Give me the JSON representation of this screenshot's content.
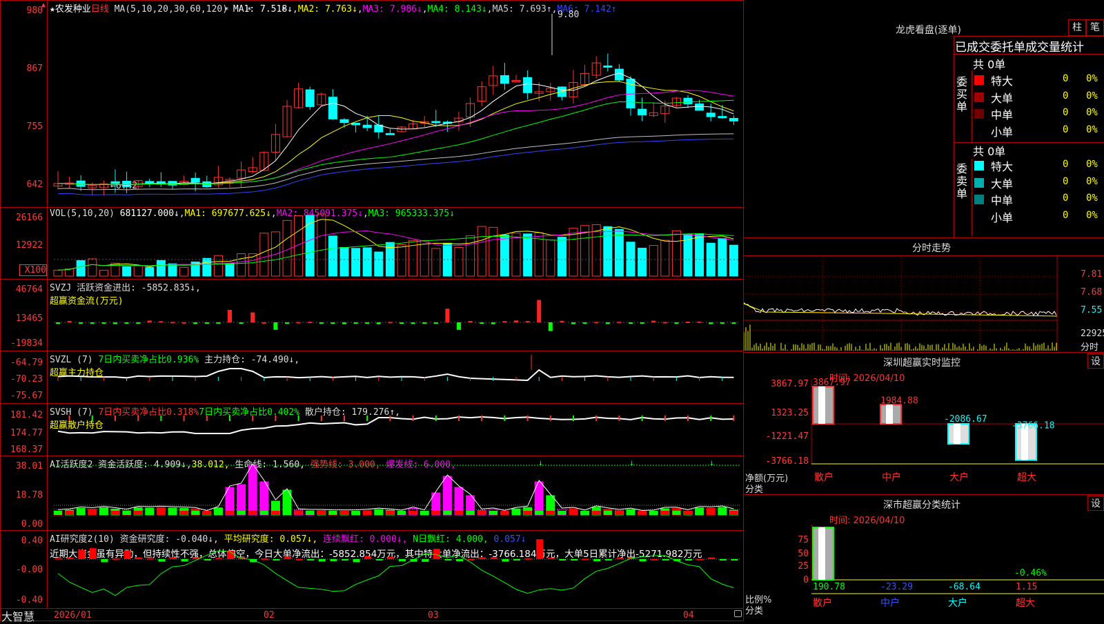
{
  "stock": {
    "star": "★",
    "name": "农发种业",
    "period": "日线"
  },
  "ma_header": {
    "label": "MA(5,10,20,30,60,120)",
    "items": [
      {
        "text": "MA1: 7.518↓",
        "color": "#ffffff"
      },
      {
        "text": "MA2: 7.763↓",
        "color": "#ffff00"
      },
      {
        "text": "MA3: 7.986↓",
        "color": "#ff00ff"
      },
      {
        "text": "MA4: 8.143↓",
        "color": "#00ff00"
      },
      {
        "text": "MA5: 7.693↑",
        "color": "#c0c0c0"
      },
      {
        "text": "MA6: 7.142↑",
        "color": "#3333ff"
      }
    ]
  },
  "price_axis": [
    "980",
    "867",
    "755",
    "642"
  ],
  "price_high_label": "9.80",
  "price_low_label": "←6.42",
  "vol_header": {
    "label": "VOL(5,10,20)",
    "items": [
      {
        "text": "681127.000↓",
        "color": "#ffffff"
      },
      {
        "text": "MA1: 697677.625↓",
        "color": "#ffff00"
      },
      {
        "text": "MA2: 845091.375↓",
        "color": "#ff00ff"
      },
      {
        "text": "MA3: 965333.375↓",
        "color": "#00ff00"
      }
    ]
  },
  "vol_axis": [
    "26166",
    "12922",
    "X100"
  ],
  "svzj": {
    "line1": "SVZJ  活跃资金进出: -5852.835↓,",
    "line2": "超赢资金流(万元)",
    "axis": [
      "46764",
      "13465",
      "-19834"
    ]
  },
  "svzl": {
    "line1a": "SVZL (7) ",
    "line1b": "7日内买卖净占比0.936%",
    "line1c": " 主力持仓: -74.490↓,",
    "line2": "超赢主力持仓",
    "axis": [
      "-64.79",
      "-70.23",
      "-75.67"
    ]
  },
  "svsh": {
    "line1a": "SVSH (7) ",
    "line1b": "7日内买卖净占比0.318%",
    "line1c": "7日内买卖净占比0.402%",
    "line1d": " 散户持仓: 179.276↑,",
    "line2": "超赢散户持仓",
    "axis": [
      "181.42",
      "174.77",
      "168.37"
    ]
  },
  "ai2": {
    "a": "AI活跃度2 资金活跃度: 4.909↓,",
    "b": "38.012,",
    "c": " 生命线: 1.560,",
    "d": " 强势线: 3.000,",
    "e": " 爆发线: 6.000,",
    "axis": [
      "38.01",
      "18.78",
      "0.00"
    ]
  },
  "aiy": {
    "a": "AI研究度2(10) 资金研究度: -0.040↓,",
    "b": " 平均研究度: 0.057↓,",
    "c": " 连续飘红: 0.000↓,",
    "d": " N日飘红: 4.000,",
    "e": " 0.057↓",
    "line2": "近期大资金虽有异动，但持续性不强，总体偏空，今日大单净流出：-5852.854万元，其中特大单净流出：-3766.184万元，大单5日累计净出-5271.982万元",
    "axis": [
      "0.40",
      "-0.00",
      "-0.40"
    ]
  },
  "date_axis": [
    "2026/01",
    "02",
    "03",
    "04"
  ],
  "brand": "大智慧",
  "dragon": {
    "title": "龙虎看盘(逐单)",
    "btn1": "柱",
    "btn2": "笔",
    "subtitle": "已成交委托单成交量统计",
    "buy": {
      "side": "委买单",
      "total": "共 0单",
      "rows": [
        {
          "label": "特大",
          "val": "0",
          "pct": "0%",
          "color": "#ff0000"
        },
        {
          "label": "大单",
          "val": "0",
          "pct": "0%",
          "color": "#a00000"
        },
        {
          "label": "中单",
          "val": "0",
          "pct": "0%",
          "color": "#700000"
        },
        {
          "label": "小单",
          "val": "0",
          "pct": "0%",
          "color": "#000000"
        }
      ]
    },
    "sell": {
      "side": "委卖单",
      "total": "共 0单",
      "rows": [
        {
          "label": "特大",
          "val": "0",
          "pct": "0%",
          "color": "#00ffff"
        },
        {
          "label": "大单",
          "val": "0",
          "pct": "0%",
          "color": "#00b0b0"
        },
        {
          "label": "中单",
          "val": "0",
          "pct": "0%",
          "color": "#008080"
        },
        {
          "label": "小单",
          "val": "0",
          "pct": "0%",
          "color": "#000000"
        }
      ]
    }
  },
  "intraday": {
    "title": "分时走势",
    "axis": [
      "7.81",
      "7.68",
      "7.55",
      "22925"
    ],
    "bottom": "分时"
  },
  "sz_monitor": {
    "title": "深圳超赢实时监控",
    "btn": "设",
    "time": "时间: 2026/04/10",
    "axis": [
      "3867.97",
      "1323.25",
      "-1221.47",
      "-3766.18"
    ],
    "ylabel": "净额(万元)",
    "xlabel": "分类",
    "bars": [
      {
        "cat": "散户",
        "value": 3867.97,
        "label": "3867.97"
      },
      {
        "cat": "中户",
        "value": 1984.88,
        "label": "1984.88"
      },
      {
        "cat": "大户",
        "value": -2086.67,
        "label": "-2086.67"
      },
      {
        "cat": "超大",
        "value": -3766.18,
        "label": "-3766.18"
      }
    ]
  },
  "sz_class": {
    "title": "深市超赢分类统计",
    "btn": "设",
    "time": "时间: 2026/04/10",
    "axis": [
      "75",
      "50",
      "25",
      "0"
    ],
    "ylabel": "比例%",
    "xlabel": "分类",
    "cats": [
      "散户",
      "中户",
      "大户",
      "超大"
    ],
    "values": [
      {
        "text": "190.78",
        "color": "#00ff00"
      },
      {
        "text": "-23.29",
        "color": "#3355ff"
      },
      {
        "text": "-68.64",
        "color": "#00ffff"
      },
      {
        "text": "1.15",
        "color": "#ff3333"
      }
    ],
    "extra": "-0.46%"
  },
  "colors": {
    "up": "#ff3333",
    "down": "#00ffff",
    "grid": "#b00000",
    "axis": "#ff3b3b"
  }
}
